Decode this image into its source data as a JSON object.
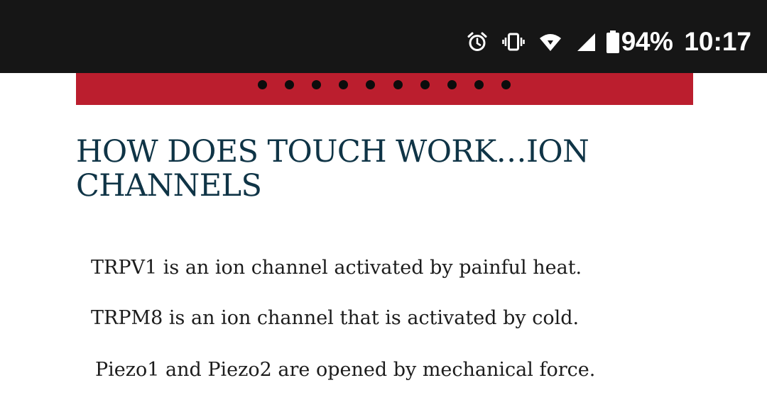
{
  "status_bar": {
    "icons": [
      "alarm-icon",
      "vibrate-icon",
      "wifi-icon",
      "cell-signal-icon",
      "battery-icon"
    ],
    "battery_percent": "94%",
    "time": "10:17"
  },
  "banner": {
    "color": "#bb1e2e",
    "slide_count": 10
  },
  "article": {
    "heading": "HOW DOES TOUCH WORK…ION CHANNELS",
    "paragraphs": [
      "TRPV1 is an ion channel activated by painful heat.",
      "TRPM8 is an ion channel that is activated by cold.",
      "Piezo1 and Piezo2 are opened by mechanical force."
    ]
  }
}
